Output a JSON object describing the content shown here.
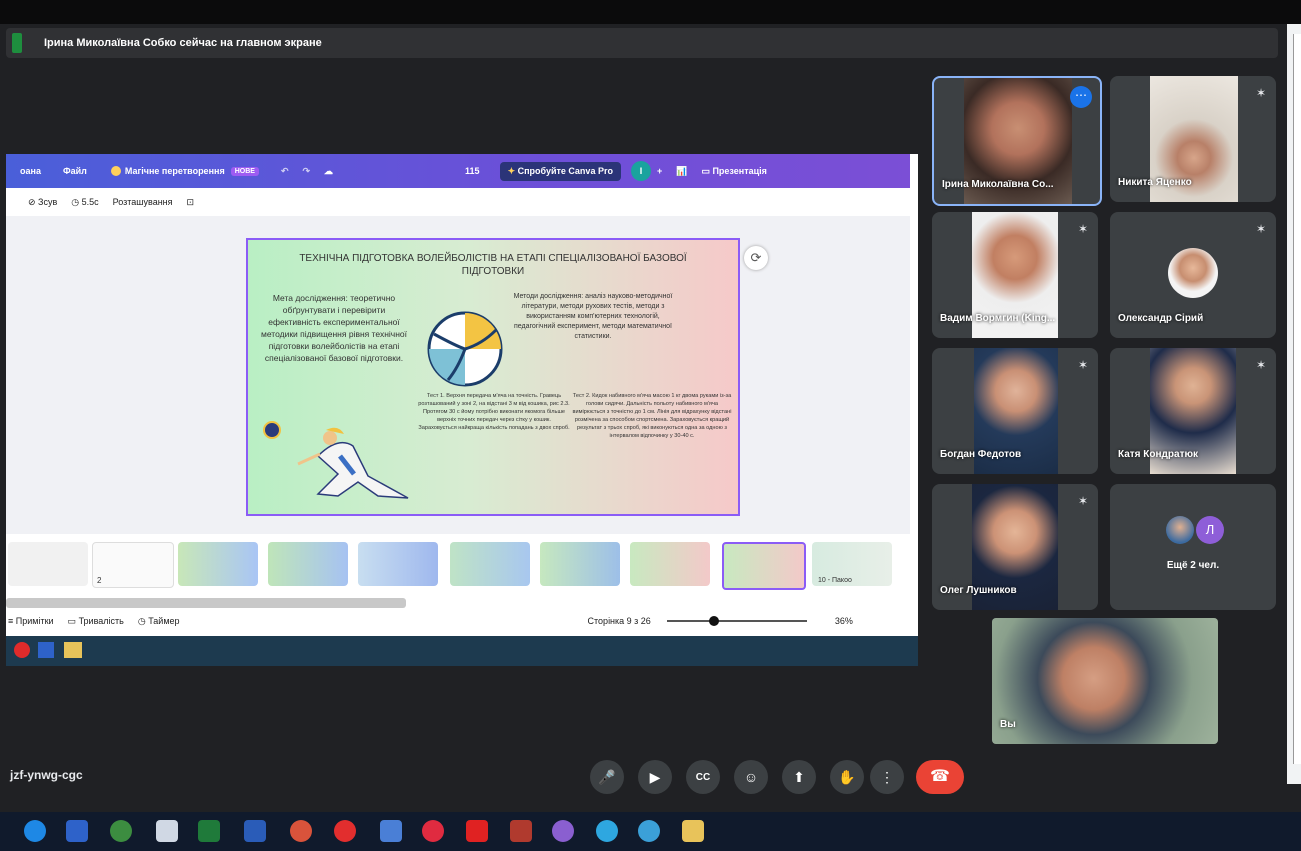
{
  "presenter_bar": {
    "text": "Ірина Миколаївна Собко сейчас на главном экране"
  },
  "canva": {
    "menu": {
      "home": "оана",
      "file": "Файл",
      "magic": "Магічне перетворення",
      "magic_badge": "НОВЕ",
      "counter": "115",
      "try_pro": "Спробуйте Canva Pro",
      "present": "Презентація"
    },
    "toolbar": {
      "zoom": "Зсув",
      "timing": "5.5с",
      "arrange": "Розташування"
    },
    "slide": {
      "title": "ТЕХНІЧНА ПІДГОТОВКА ВОЛЕЙБОЛІСТІВ НА ЕТАПІ СПЕЦІАЛІЗОВАНОЇ БАЗОВОЇ ПІДГОТОВКИ",
      "left_text": "Мета дослідження: теоретично обґрунтувати і перевірити ефективність експериментальної методики підвищення рівня технічної підготовки волейболістів на етапі спеціалізованої базової підготовки.",
      "right_text": "Методи дослідження: аналіз науково-методичної літератури, методи рухових тестів, методи з використанням комп'ютерних технологій, педагогічний експеримент, методи математичної статистики.",
      "test1": "Тест 1. Верхня передача м'яча на точність. Гравець розташований у зоні 2, на відстані 3 м від кошика, рис 2.3. Протягом 30 с йому потрібно виконати якомога більше верхніх точних передач через сітку у кошик. Зараховується найкраща кількість попадань з двох спроб.",
      "test2": "Тест 2. Кидок набивного м'яча масою 1 кг двома руками із-за голови сидячи. Дальність польоту набивного м'яча вимірюється з точністю до 1 см. Лінія для відрахунку відстані розмічена за способом спортсмена. Зараховується кращий результат з трьох спроб, які виконуються одна за одною з інтервалом відпочинку у 30-40 с."
    },
    "thumb_label": "10 - Пакоо",
    "thumb_num": "2",
    "footer": {
      "notes": "Примітки",
      "duration": "Тривалість",
      "timer": "Таймер",
      "page": "Сторінка 9 з 26",
      "zoom": "36%"
    }
  },
  "participants": [
    {
      "name": "Ірина Миколаївна Со..."
    },
    {
      "name": "Никита Яценко"
    },
    {
      "name": "Вадим Вормгин (King..."
    },
    {
      "name": "Олександр Сірий"
    },
    {
      "name": "Богдан Федотов"
    },
    {
      "name": "Катя Кондратюк"
    },
    {
      "name": "Олег Лушников"
    },
    {
      "name": "Ещё 2 чел.",
      "avatar_letter": "Л"
    },
    {
      "name": "Вы"
    }
  ],
  "meeting": {
    "code": "jzf-ynwg-cgc"
  },
  "colors": {
    "hangup": "#ea4335",
    "tile_bg": "#3c4043",
    "page_bg": "#202124",
    "accent": "#8ab4f8"
  },
  "icons": [
    "mic-icon",
    "camera-icon",
    "captions-icon",
    "emoji-icon",
    "present-icon",
    "hand-icon",
    "more-icon",
    "hangup-icon"
  ]
}
